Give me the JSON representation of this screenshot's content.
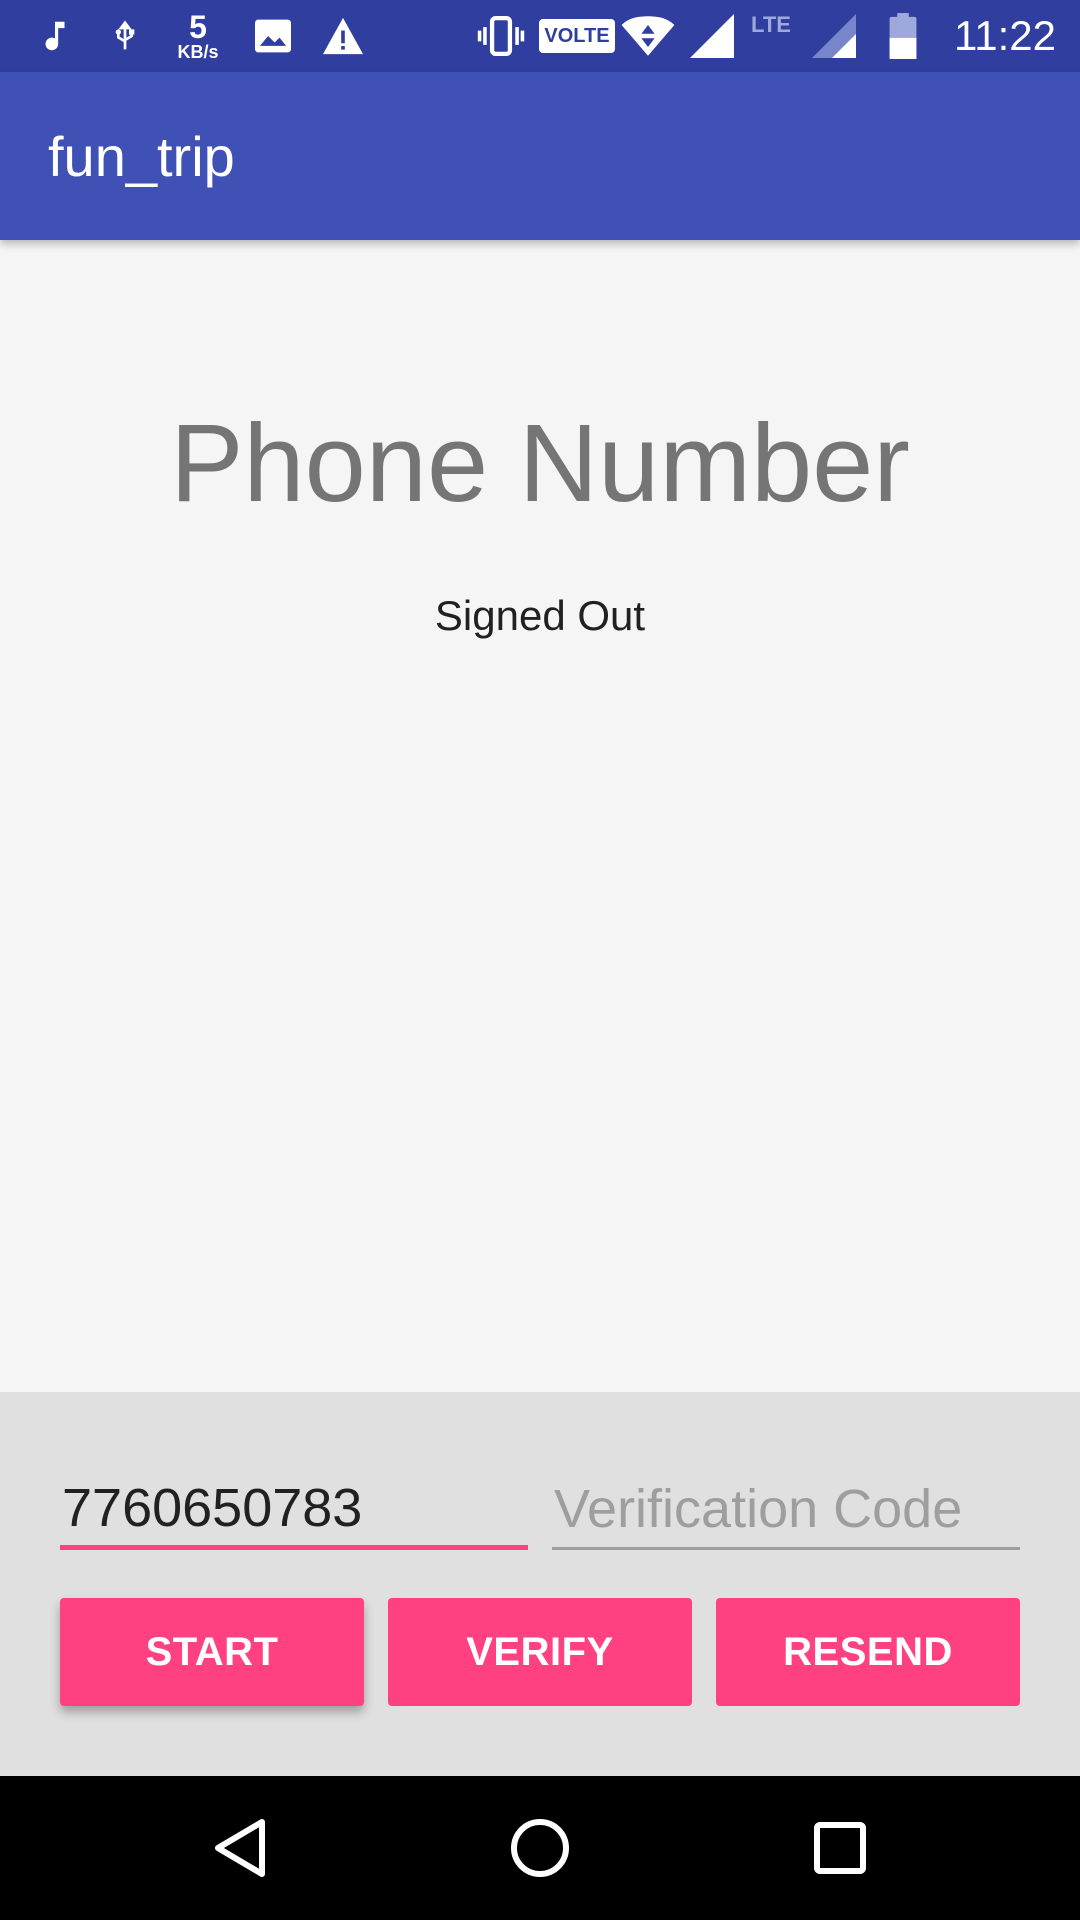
{
  "status_bar": {
    "time": "11:22",
    "speed_value": "5",
    "speed_unit": "KB/s",
    "volte_label": "VOLTE",
    "lte_label": "LTE",
    "icons": [
      "music-icon",
      "usb-icon",
      "image-icon",
      "warning-icon",
      "vibrate-icon",
      "wifi-icon",
      "signal-icon",
      "signal-icon-2",
      "battery-icon"
    ]
  },
  "app_bar": {
    "title": "fun_trip"
  },
  "main": {
    "title": "Phone Number",
    "status": "Signed Out"
  },
  "form": {
    "phone_value": "7760650783",
    "code_placeholder": "Verification Code",
    "start_label": "START",
    "verify_label": "VERIFY",
    "resend_label": "RESEND"
  },
  "nav_bar": {
    "icons": [
      "back-icon",
      "home-icon",
      "recents-icon"
    ]
  },
  "colors": {
    "status_bar": "#303f9f",
    "app_bar": "#3f51b5",
    "accent": "#ff4081",
    "panel": "#e0e0e0",
    "background": "#f5f5f5"
  }
}
